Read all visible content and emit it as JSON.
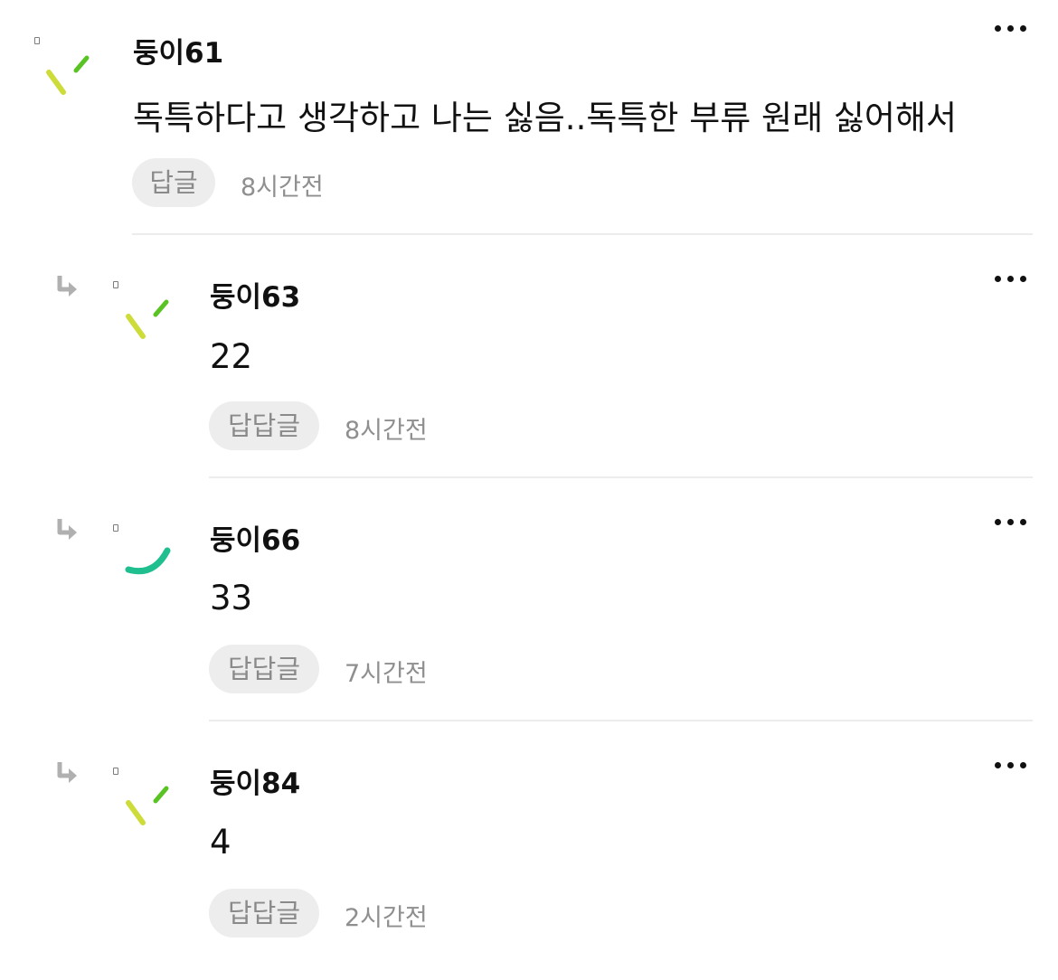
{
  "comments": [
    {
      "nickname": "둥이61",
      "text": "독특하다고 생각하고 나는 싫음..독특한 부류 원래 싫어해서",
      "reply_label": "답글",
      "time": "8시간전",
      "avatar_style": "dashes",
      "is_reply": false
    },
    {
      "nickname": "둥이63",
      "text": "22",
      "reply_label": "답답글",
      "time": "8시간전",
      "avatar_style": "dashes",
      "is_reply": true
    },
    {
      "nickname": "둥이66",
      "text": "33",
      "reply_label": "답답글",
      "time": "7시간전",
      "avatar_style": "arc",
      "is_reply": true
    },
    {
      "nickname": "둥이84",
      "text": "4",
      "reply_label": "답답글",
      "time": "2시간전",
      "avatar_style": "dashes",
      "is_reply": true
    }
  ],
  "icons": {
    "more": "more-dots-icon",
    "reply": "reply-arrow-icon"
  },
  "colors": {
    "avatar_yellow": "#cddc39",
    "avatar_green": "#58c322",
    "avatar_teal": "#1fbf8f",
    "reply_bg": "#ededed",
    "muted_text": "#8f8f8f"
  }
}
